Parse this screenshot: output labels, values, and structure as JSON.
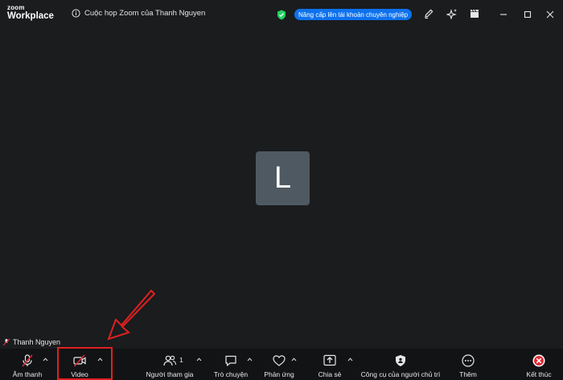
{
  "titlebar": {
    "logo_top": "zoom",
    "logo_bottom": "Workplace",
    "meeting_title": "Cuộc họp Zoom của Thanh Nguyen",
    "upgrade_label": "Nâng cấp lên tài khoản chuyên nghiệp"
  },
  "stage": {
    "avatar_letter": "L",
    "participant_name": "Thanh Nguyen"
  },
  "toolbar": {
    "audio_label": "Âm thanh",
    "video_label": "Video",
    "participants_label": "Người tham gia",
    "participants_count": "1",
    "chat_label": "Trò chuyện",
    "reactions_label": "Phản ứng",
    "share_label": "Chia sẻ",
    "host_tools_label": "Công cụ của người chủ trì",
    "more_label": "Thêm",
    "end_label": "Kết thúc"
  },
  "colors": {
    "background": "#1a1c1e",
    "toolbar": "#121315",
    "upgrade_badge": "#0e72ed",
    "annotation_red": "#e02020",
    "avatar_tile": "#4f5961",
    "end_red": "#e02b35",
    "shield_green": "#23d160"
  },
  "icons": [
    "info-icon",
    "shield-icon",
    "pen-icon",
    "sparkle-icon",
    "clapper-icon",
    "minimize-icon",
    "maximize-icon",
    "close-icon",
    "mic-muted-icon",
    "video-off-icon",
    "participants-icon",
    "chat-icon",
    "heart-icon",
    "share-icon",
    "host-shield-icon",
    "more-icon",
    "end-icon"
  ]
}
